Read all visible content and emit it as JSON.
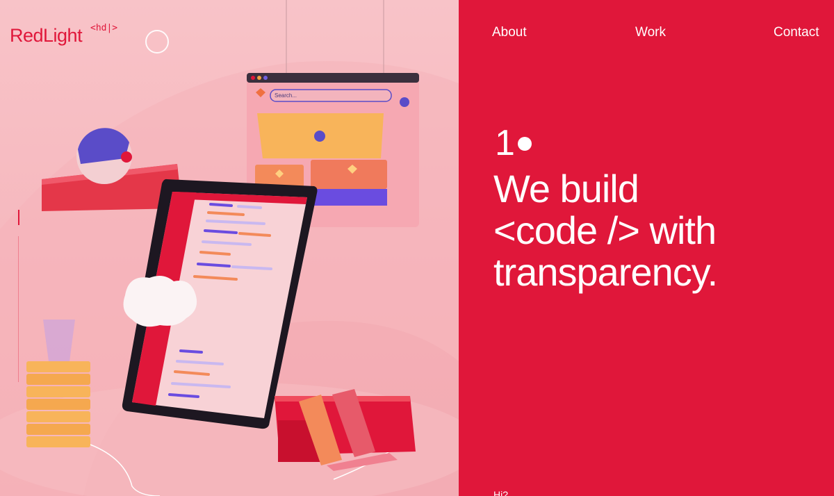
{
  "brand": {
    "name": "RedLight",
    "tag": "<hd|>"
  },
  "nav": [
    {
      "label": "About"
    },
    {
      "label": "Work"
    },
    {
      "label": "Contact"
    }
  ],
  "hero": {
    "number": "1",
    "lines": [
      "We build",
      "<code /> with",
      "transparency."
    ]
  },
  "scene": {
    "search_placeholder": "Search..."
  },
  "footer_fragment": "Hi?",
  "colors": {
    "accent": "#e0173a",
    "background_left": "#f7c0c5",
    "text_on_accent": "#ffffff"
  }
}
